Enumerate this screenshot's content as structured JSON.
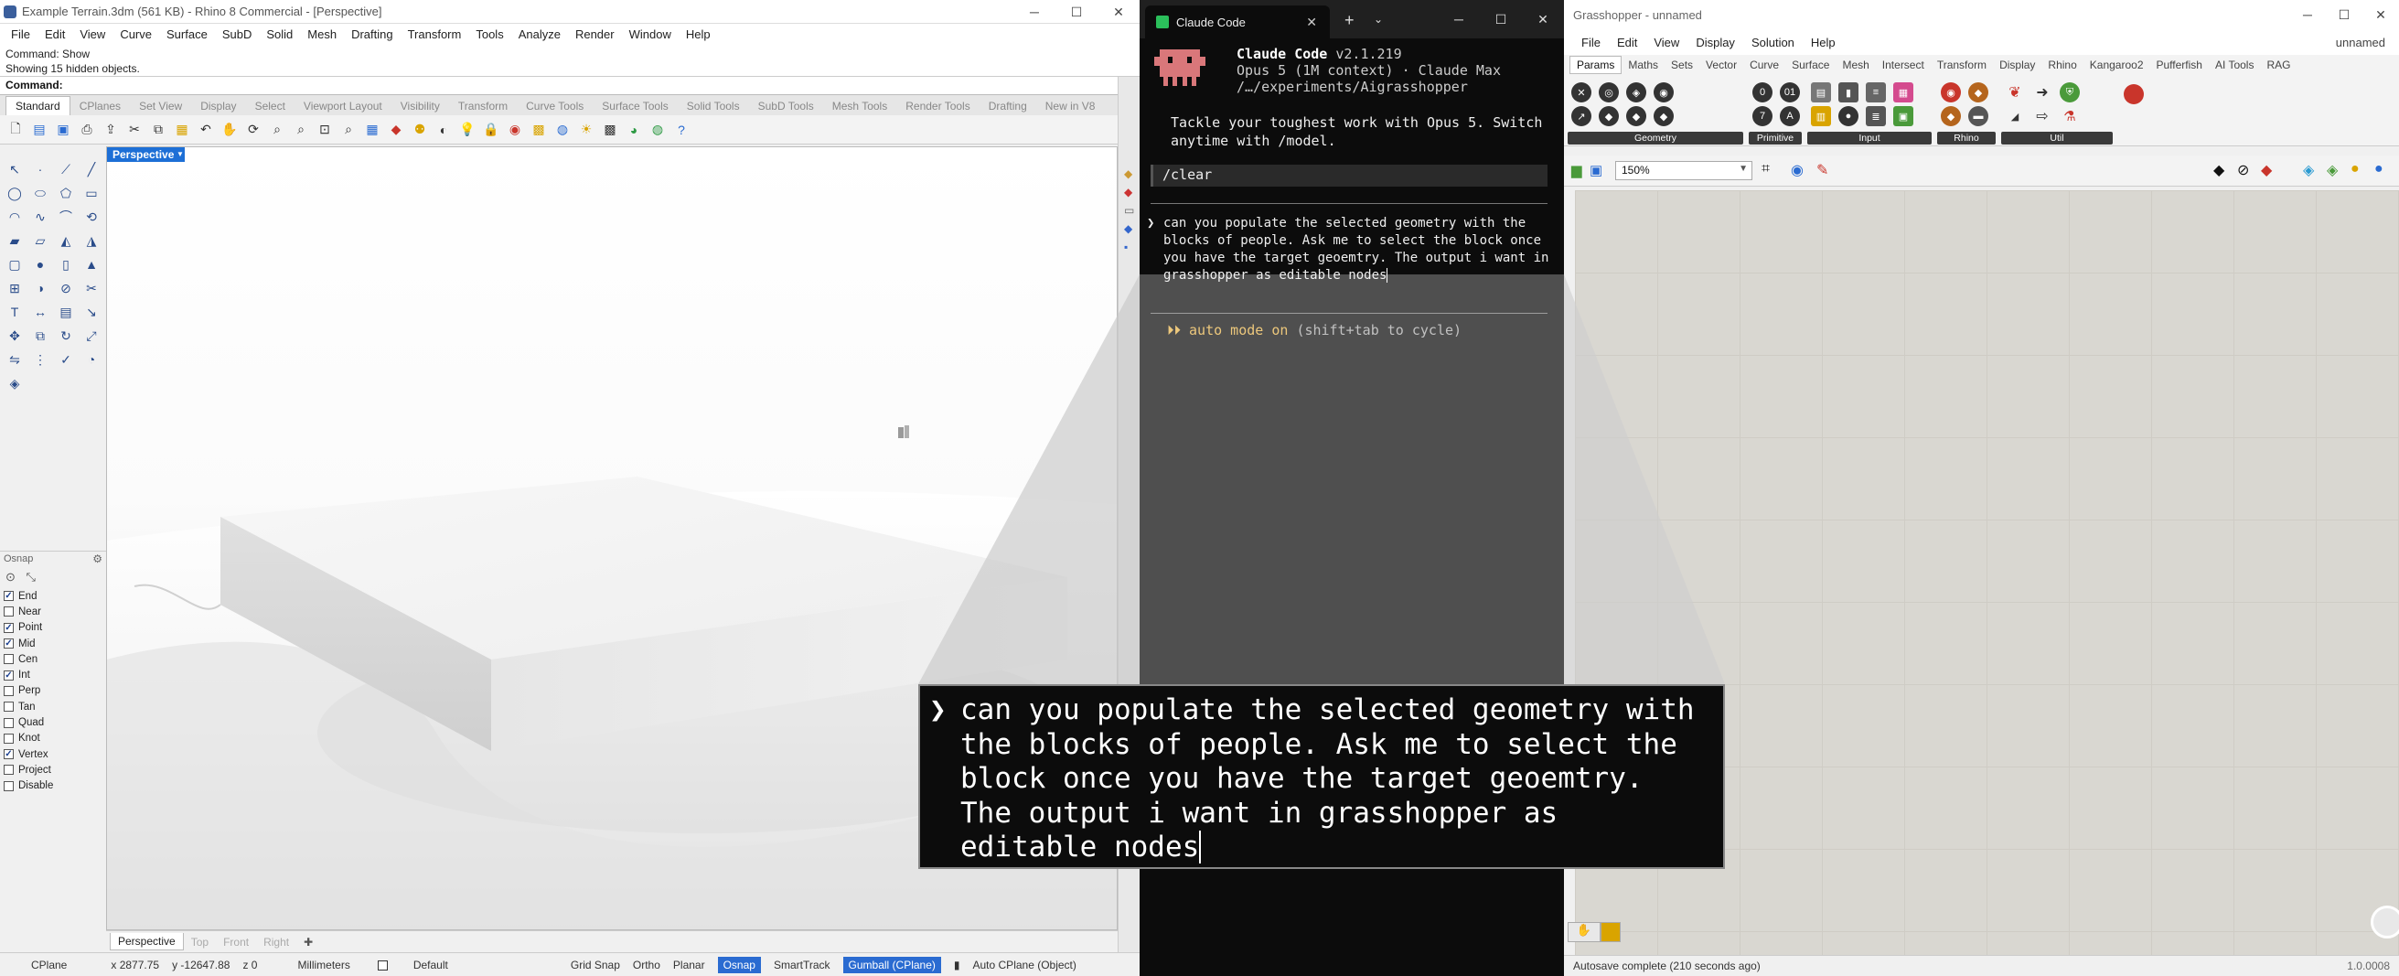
{
  "rhino": {
    "title": "Example Terrain.3dm (561 KB) - Rhino 8 Commercial - [Perspective]",
    "menu": [
      "File",
      "Edit",
      "View",
      "Curve",
      "Surface",
      "SubD",
      "Solid",
      "Mesh",
      "Drafting",
      "Transform",
      "Tools",
      "Analyze",
      "Render",
      "Window",
      "Help"
    ],
    "command_history": [
      "Command: Show",
      "Showing 15 hidden objects."
    ],
    "command_prompt": "Command:",
    "toolbar_tabs": [
      "Standard",
      "CPlanes",
      "Set View",
      "Display",
      "Select",
      "Viewport Layout",
      "Visibility",
      "Transform",
      "Curve Tools",
      "Surface Tools",
      "Solid Tools",
      "SubD Tools",
      "Mesh Tools",
      "Render Tools",
      "Drafting",
      "New in V8"
    ],
    "viewport_label": "Perspective",
    "viewport_tabs": [
      "Perspective",
      "Top",
      "Front",
      "Right"
    ],
    "osnap_title": "Osnap",
    "osnaps": [
      {
        "label": "End",
        "checked": true
      },
      {
        "label": "Near",
        "checked": false
      },
      {
        "label": "Point",
        "checked": true
      },
      {
        "label": "Mid",
        "checked": true
      },
      {
        "label": "Cen",
        "checked": false
      },
      {
        "label": "Int",
        "checked": true
      },
      {
        "label": "Perp",
        "checked": false
      },
      {
        "label": "Tan",
        "checked": false
      },
      {
        "label": "Quad",
        "checked": false
      },
      {
        "label": "Knot",
        "checked": false
      },
      {
        "label": "Vertex",
        "checked": true
      },
      {
        "label": "Project",
        "checked": false
      },
      {
        "label": "Disable",
        "checked": false
      }
    ],
    "status": {
      "cplane": "CPlane",
      "x": "x 2877.75",
      "y": "y -12647.88",
      "z": "z 0",
      "units": "Millimeters",
      "layer": "Default",
      "grid_snap": "Grid Snap",
      "ortho": "Ortho",
      "planar": "Planar",
      "osnap": "Osnap",
      "smarttrack": "SmartTrack",
      "gumball": "Gumball (CPlane)",
      "autocplane": "Auto CPlane (Object)"
    }
  },
  "claude": {
    "tab_title": "Claude Code",
    "app_name": "Claude Code",
    "version": "v2.1.219",
    "model_line": "Opus 5 (1M context) · Claude Max",
    "path": "/…/experiments/Aigrasshopper",
    "tip": "Tackle your toughest work with Opus 5. Switch anytime with /model.",
    "last_command": "/clear",
    "prompt_text": "can you populate the selected geometry with the blocks of people. Ask me to select the block once you have the target geoemtry. The output i want in grasshopper as editable nodes",
    "auto_mode_label": "⏵⏵ auto mode on",
    "auto_mode_hint": "(shift+tab to cycle)"
  },
  "grasshopper": {
    "title": "Grasshopper - unnamed",
    "title_right": "unnamed",
    "menu": [
      "File",
      "Edit",
      "View",
      "Display",
      "Solution",
      "Help"
    ],
    "tabs": [
      "Params",
      "Maths",
      "Sets",
      "Vector",
      "Curve",
      "Surface",
      "Mesh",
      "Intersect",
      "Transform",
      "Display",
      "Rhino",
      "Kangaroo2",
      "Pufferfish",
      "AI Tools",
      "RAG"
    ],
    "ribbon_groups": [
      "Geometry",
      "Primitive",
      "Input",
      "Rhino",
      "Util"
    ],
    "zoom": "150%",
    "status": "Autosave complete (210 seconds ago)",
    "version": "1.0.0008"
  },
  "colors": {
    "rhino_accent": "#1d6fd6",
    "claude_bg": "#0c0c0c",
    "claude_auto": "#e6b34a",
    "claude_mascot": "#d9777a",
    "gh_canvas": "#d9d7d1"
  }
}
